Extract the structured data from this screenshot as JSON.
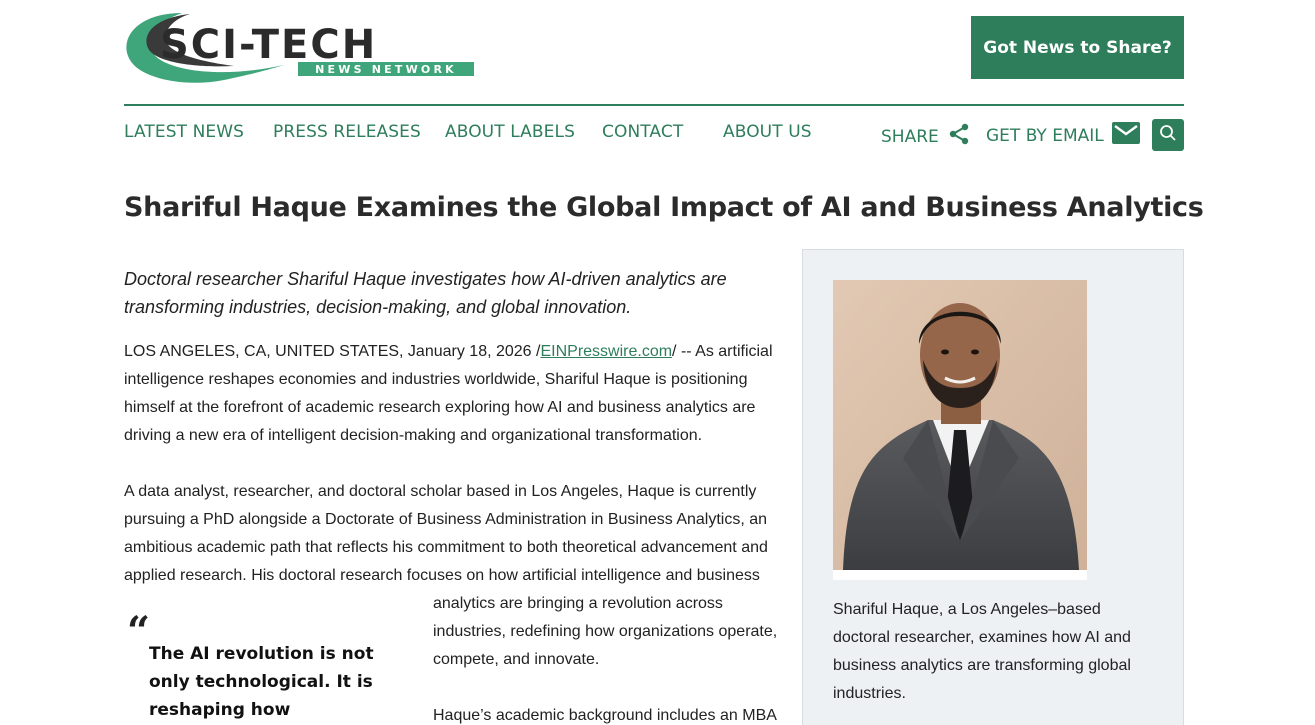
{
  "header": {
    "logo": {
      "main_text": "SCI-TECH",
      "sub_text": "NEWS NETWORK"
    },
    "cta_label": "Got News to Share?"
  },
  "nav": {
    "items": [
      {
        "label": "LATEST NEWS"
      },
      {
        "label": "PRESS RELEASES"
      },
      {
        "label": "ABOUT LABELS"
      },
      {
        "label": "CONTACT"
      },
      {
        "label": "ABOUT US"
      }
    ],
    "share_label": "SHARE",
    "email_label": "GET BY EMAIL",
    "search_icon": "search-icon"
  },
  "article": {
    "headline": "Shariful Haque Examines the Global Impact of AI and Business Analytics",
    "subhead": "Doctoral researcher Shariful Haque investigates how AI-driven analytics are transforming industries, decision-making, and global innovation.",
    "p1_prefix": "LOS ANGELES, CA, UNITED STATES, January 18, 2026 /",
    "p1_link": "EINPresswire.com",
    "p1_suffix": "/ -- As artificial intelligence reshapes economies and industries worldwide, Shariful Haque is positioning himself at the forefront of academic research exploring how AI and business analytics are driving a new era of intelligent decision-making and organizational transformation.",
    "p2": "A data analyst, researcher, and doctoral scholar based in Los Angeles, Haque is currently pursuing a PhD alongside a Doctorate of Business Administration in Business Analytics, an ambitious academic path that reflects his commitment to both theoretical advancement and applied research. His doctoral research focuses on how artificial intelligence and business",
    "p3": "analytics are bringing a revolution across industries, redefining how organizations operate, compete, and innovate.",
    "p4": "Haque’s academic background includes an MBA",
    "quote": "The AI revolution is not only technological. It is reshaping how organizations make"
  },
  "sidebar": {
    "caption": "Shariful Haque, a Los Angeles–based doctoral researcher, examines how AI and business analytics are transforming global industries."
  },
  "colors": {
    "brand_green": "#2e7d5b",
    "logo_light_green": "#3fa57a",
    "logo_dark": "#3a3a3a"
  }
}
